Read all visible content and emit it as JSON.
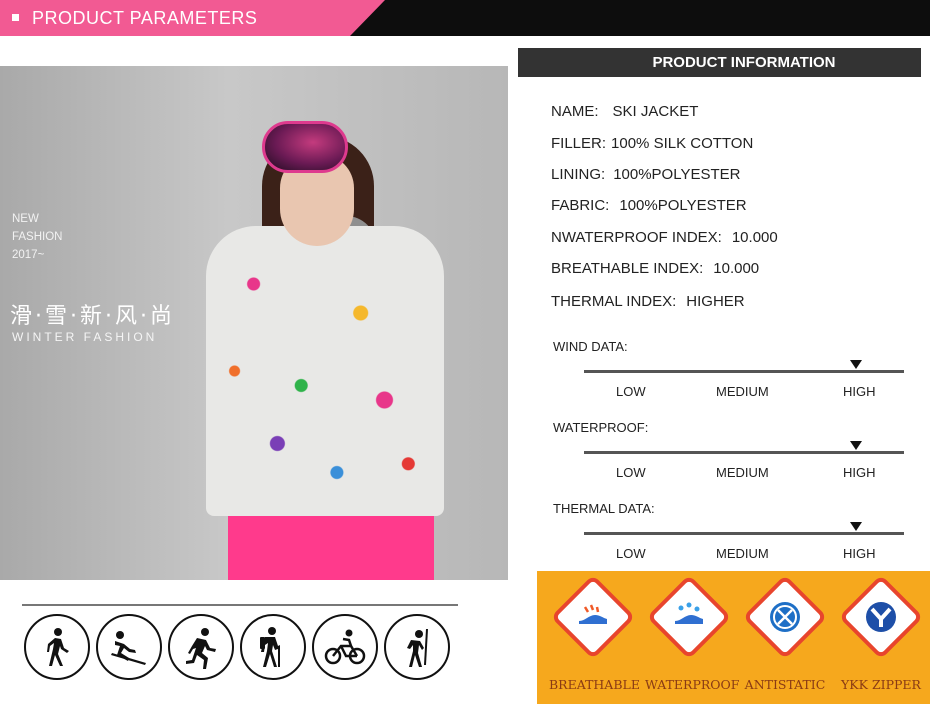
{
  "header": {
    "title": "PRODUCT PARAMETERS"
  },
  "photo": {
    "new_line1": "NEW",
    "new_line2": "FASHION",
    "new_line3": "2017~",
    "cn_title": "滑·雪·新·风·尚",
    "subtitle": "WINTER FASHION"
  },
  "activities": [
    "walking-icon",
    "skiing-icon",
    "running-icon",
    "hiking-icon",
    "cycling-icon",
    "climbing-icon"
  ],
  "info": {
    "title": "PRODUCT INFORMATION",
    "specs": [
      {
        "label": "NAME:",
        "value": "SKI JACKET"
      },
      {
        "label": "FILLER:",
        "value": "100% SILK COTTON"
      },
      {
        "label": "LINING:",
        "value": "100%POLYESTER"
      },
      {
        "label": "FABRIC:",
        "value": "100%POLYESTER"
      },
      {
        "label": "NWATERPROOF INDEX:",
        "value": "10.000"
      },
      {
        "label": "BREATHABLE INDEX:",
        "value": "10.000"
      },
      {
        "label": "THERMAL INDEX:",
        "value": "HIGHER"
      }
    ]
  },
  "scales": [
    {
      "title": "WIND DATA:",
      "low": "LOW",
      "medium": "MEDIUM",
      "high": "HIGH",
      "selected": "HIGH"
    },
    {
      "title": "WATERPROOF:",
      "low": "LOW",
      "medium": "MEDIUM",
      "high": "HIGH",
      "selected": "HIGH"
    },
    {
      "title": "THERMAL DATA:",
      "low": "LOW",
      "medium": "MEDIUM",
      "high": "HIGH",
      "selected": "HIGH"
    }
  ],
  "features": [
    {
      "label": "BREATHABLE",
      "icon": "shoe-breathable-icon"
    },
    {
      "label": "WATERPROOF",
      "icon": "shoe-waterproof-icon"
    },
    {
      "label": "ANTISTATIC",
      "icon": "antistatic-icon"
    },
    {
      "label": "YKK ZIPPER",
      "icon": "ykk-logo-icon"
    }
  ],
  "colors": {
    "accent": "#f25a93",
    "header_bg": "#0d0d0d",
    "info_bar": "#333333",
    "features_bg": "#f6a81d",
    "feature_text": "#8a3b14"
  }
}
